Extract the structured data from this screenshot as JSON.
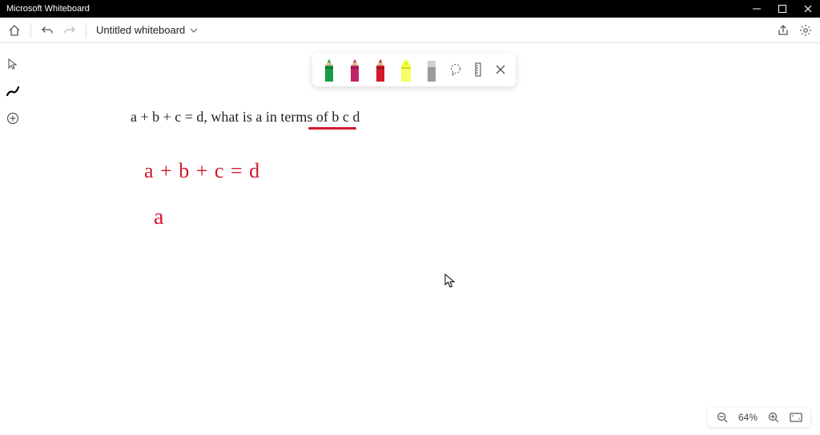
{
  "titlebar": {
    "app_name": "Microsoft Whiteboard"
  },
  "toolbar": {
    "doc_title": "Untitled whiteboard"
  },
  "canvas": {
    "typed_text": "a + b + c = d, what is a in terms of b c d",
    "hand1": "a + b + c = d",
    "hand2": "a"
  },
  "zoom": {
    "level": "64%"
  },
  "pens": {
    "green": "#1a9b4a",
    "magenta": "#c2246b",
    "red": "#d2182b",
    "yellow": "#eaff00",
    "gray": "#9b9b9b"
  }
}
